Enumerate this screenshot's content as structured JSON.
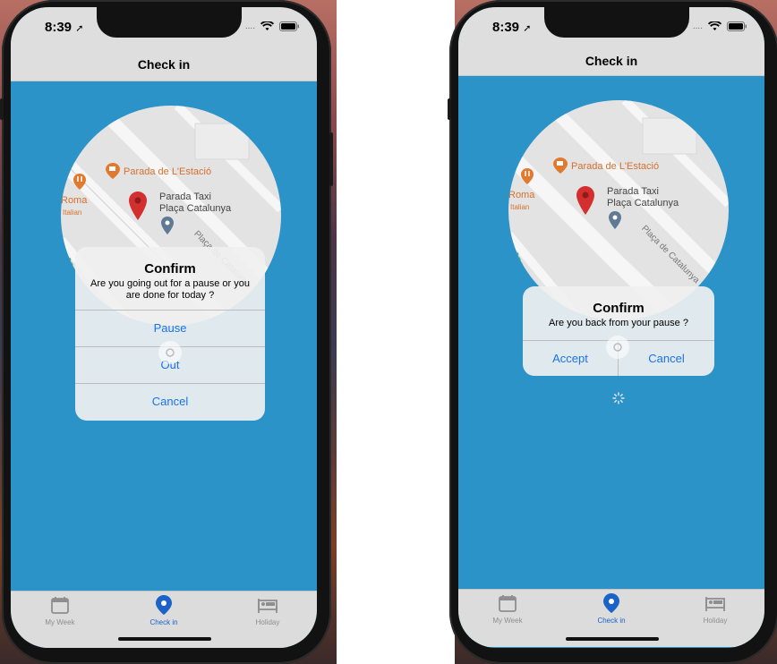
{
  "status": {
    "time": "8:39"
  },
  "nav": {
    "title": "Check in"
  },
  "map": {
    "poi_restaurant": "Parada de L'Estació",
    "poi_italian_name": "Roma",
    "poi_italian_type": "Italian",
    "taxi_line1": "Parada Taxi",
    "taxi_line2": "Plaça Catalunya",
    "street": "Plaça de Catalunya"
  },
  "left_dialog": {
    "title": "Confirm",
    "message": "Are you going out for a pause or you are done for today ?",
    "pause_label": "Pause",
    "out_label": "Out",
    "cancel_label": "Cancel"
  },
  "right_dialog": {
    "title": "Confirm",
    "message": "Are you back from your pause ?",
    "accept_label": "Accept",
    "cancel_label": "Cancel"
  },
  "tabs": [
    {
      "label": "My Week",
      "icon": "calendar-icon"
    },
    {
      "label": "Check in",
      "icon": "location-pin-icon",
      "active": true
    },
    {
      "label": "Holiday",
      "icon": "bed-icon"
    }
  ],
  "colors": {
    "screen_bg": "#2b93c7",
    "accent": "#1a73e8",
    "tab_active": "#1b63c6"
  }
}
